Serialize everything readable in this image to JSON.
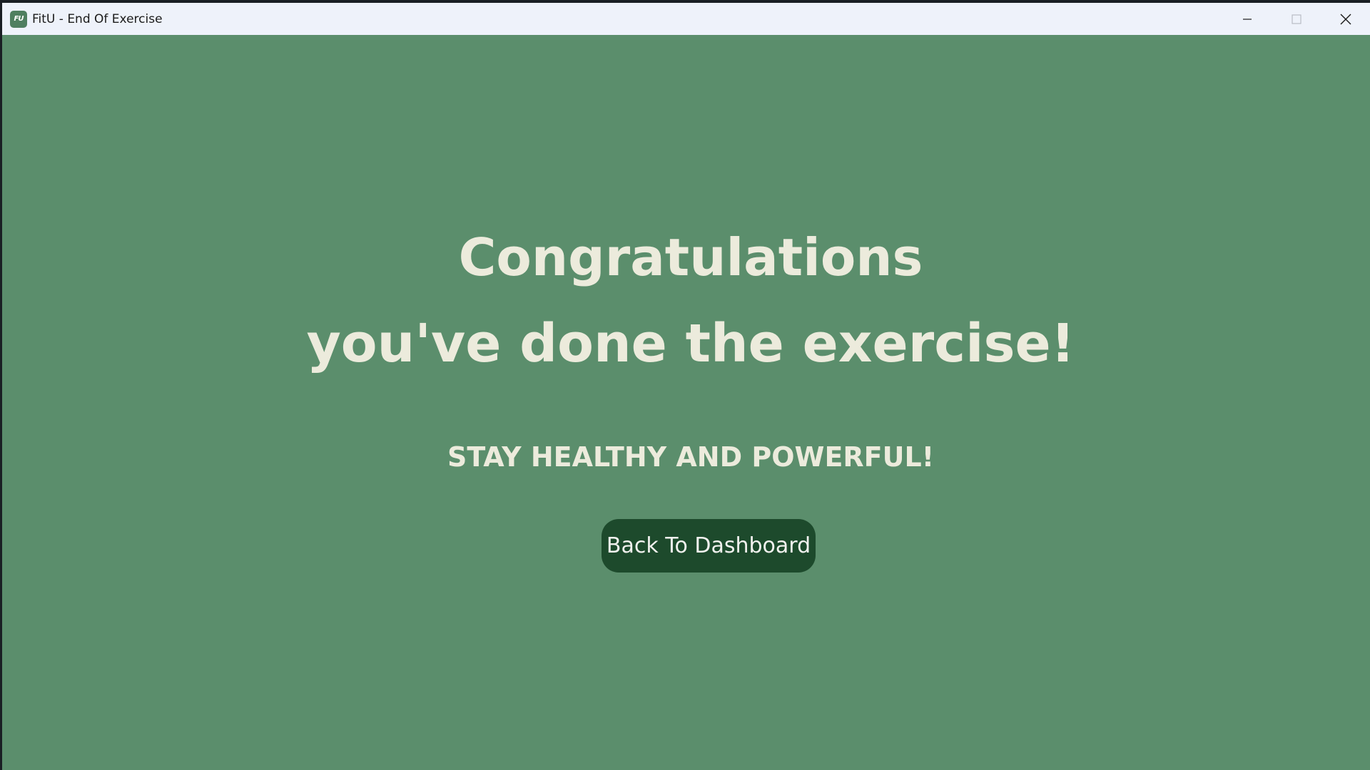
{
  "window": {
    "title": "FitU - End Of Exercise",
    "app_icon_text": "FU",
    "controls": [
      "minimize",
      "maximize",
      "close"
    ]
  },
  "main": {
    "heading_line1": "Congratulations",
    "heading_line2": "you've done the exercise!",
    "tagline": "STAY HEALTHY AND POWERFUL!",
    "back_button_label": "Back To Dashboard"
  },
  "colors": {
    "background": "#5b8e6c",
    "titlebar": "#eef2fa",
    "heading_text": "#ecebdc",
    "button_bg": "#1d4a2c",
    "button_text": "#f1f1ee"
  }
}
